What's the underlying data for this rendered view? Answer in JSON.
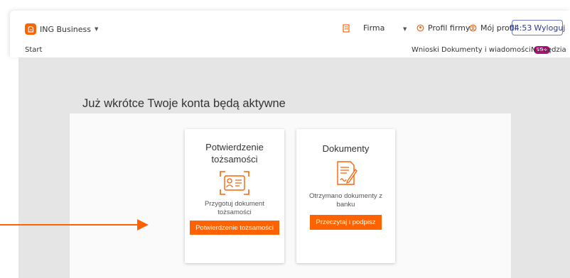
{
  "header": {
    "brand": "ING Business",
    "firma_label": "Firma",
    "profil_firmy": "Profil firmy",
    "moj_profil": "Mój profil",
    "session_time": "04:53",
    "logout_label": "Wyloguj",
    "brand_color": "#ff6200"
  },
  "nav": {
    "start": "Start",
    "wnioski": "Wnioski",
    "dokumenty": "Dokumenty i wiadomości",
    "dokumenty_badge": "99+",
    "narzedzia": "Narzędzia"
  },
  "main": {
    "heading": "Już wkrótce Twoje konta będą aktywne",
    "cards": [
      {
        "title": "Potwierdzenie tożsamości",
        "icon": "id-card-icon",
        "description": "Przygotuj dokument tożsamości",
        "button": "Potwierdzenie tożsamości"
      },
      {
        "title": "Dokumenty",
        "icon": "document-sign-icon",
        "description": "Otrzymano dokumenty z banku",
        "button": "Przeczytaj i podpisz"
      }
    ]
  }
}
